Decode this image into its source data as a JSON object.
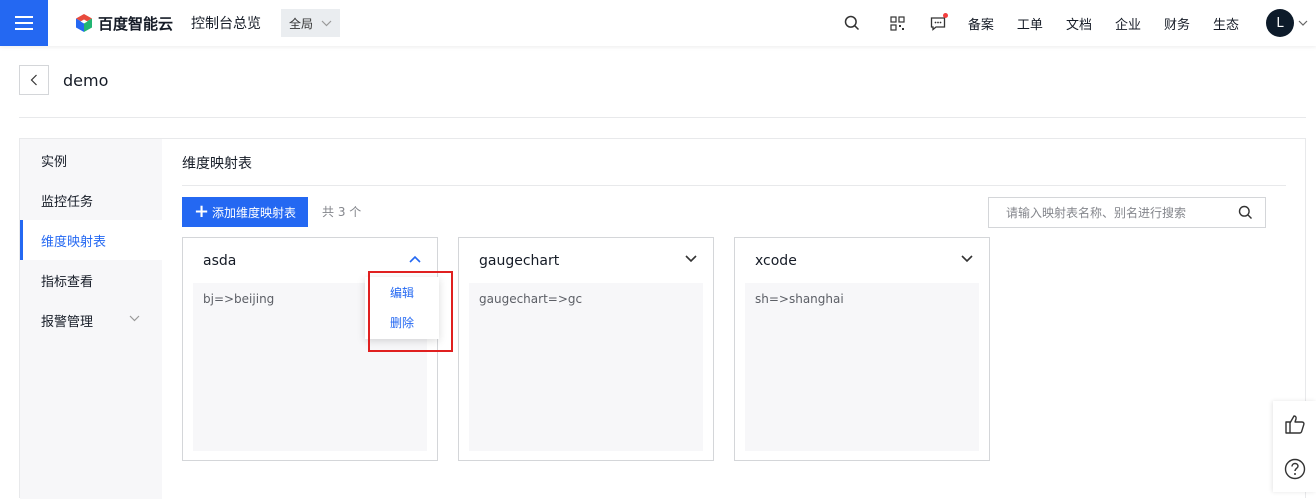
{
  "topbar": {
    "brand": "百度智能云",
    "console_title": "控制台总览",
    "region": "全局",
    "links": [
      "备案",
      "工单",
      "文档",
      "企业",
      "财务",
      "生态"
    ],
    "avatar_letter": "L"
  },
  "page": {
    "name": "demo"
  },
  "sidebar": {
    "items": [
      {
        "label": "实例"
      },
      {
        "label": "监控任务"
      },
      {
        "label": "维度映射表"
      },
      {
        "label": "指标查看"
      },
      {
        "label": "报警管理"
      }
    ]
  },
  "section": {
    "title": "维度映射表",
    "add_label": "添加维度映射表",
    "total": "共 3 个",
    "search_placeholder": "请输入映射表名称、别名进行搜索"
  },
  "cards": [
    {
      "title": "asda",
      "content": "bj=>beijing"
    },
    {
      "title": "gaugechart",
      "content": "gaugechart=>gc"
    },
    {
      "title": "xcode",
      "content": "sh=>shanghai"
    }
  ],
  "dropdown": {
    "edit": "编辑",
    "delete": "删除"
  },
  "colors": {
    "primary": "#2468f2",
    "highlight": "#e02020"
  }
}
